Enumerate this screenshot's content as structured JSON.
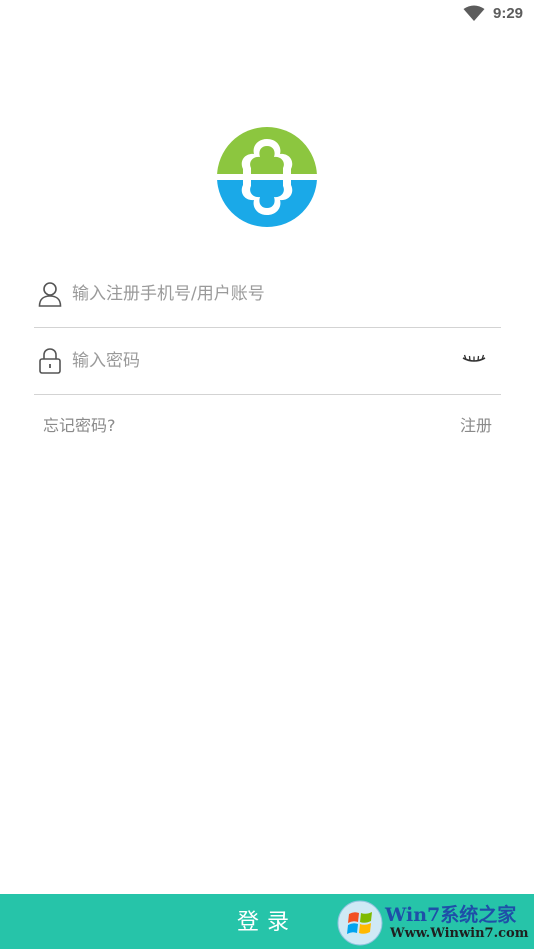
{
  "status_bar": {
    "time": "9:29",
    "wifi_icon": "wifi-icon"
  },
  "logo": {
    "icon": "app-logo",
    "colors": {
      "green": "#8cc63f",
      "blue": "#1aa9e8"
    }
  },
  "form": {
    "account": {
      "icon": "user-icon",
      "placeholder": "输入注册手机号/用户账号",
      "value": ""
    },
    "password": {
      "icon": "lock-icon",
      "placeholder": "输入密码",
      "value": "",
      "toggle_icon": "eye-closed-icon"
    },
    "forgot_password": "忘记密码?",
    "register": "注册"
  },
  "login_button": {
    "label": "登录",
    "color": "#26c4a9"
  },
  "watermark": {
    "title": "Win7系统之家",
    "url": "Www.Winwin7.com"
  }
}
